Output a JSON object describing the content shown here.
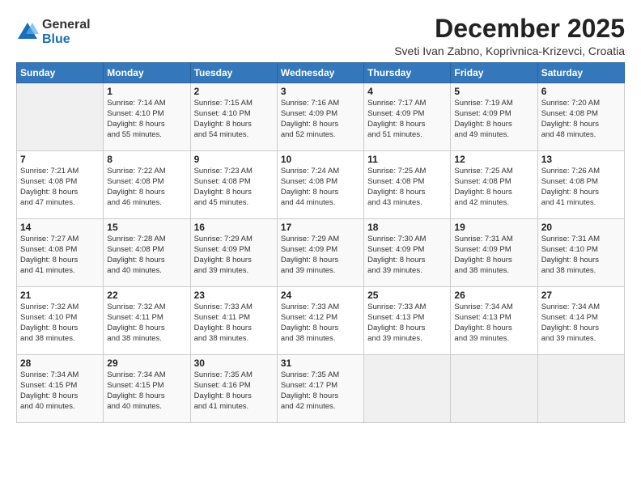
{
  "header": {
    "logo": {
      "general": "General",
      "blue": "Blue"
    },
    "title": "December 2025",
    "location": "Sveti Ivan Zabno, Koprivnica-Krizevci, Croatia"
  },
  "days_of_week": [
    "Sunday",
    "Monday",
    "Tuesday",
    "Wednesday",
    "Thursday",
    "Friday",
    "Saturday"
  ],
  "weeks": [
    [
      {
        "day": "",
        "info": ""
      },
      {
        "day": "1",
        "info": "Sunrise: 7:14 AM\nSunset: 4:10 PM\nDaylight: 8 hours\nand 55 minutes."
      },
      {
        "day": "2",
        "info": "Sunrise: 7:15 AM\nSunset: 4:10 PM\nDaylight: 8 hours\nand 54 minutes."
      },
      {
        "day": "3",
        "info": "Sunrise: 7:16 AM\nSunset: 4:09 PM\nDaylight: 8 hours\nand 52 minutes."
      },
      {
        "day": "4",
        "info": "Sunrise: 7:17 AM\nSunset: 4:09 PM\nDaylight: 8 hours\nand 51 minutes."
      },
      {
        "day": "5",
        "info": "Sunrise: 7:19 AM\nSunset: 4:09 PM\nDaylight: 8 hours\nand 49 minutes."
      },
      {
        "day": "6",
        "info": "Sunrise: 7:20 AM\nSunset: 4:08 PM\nDaylight: 8 hours\nand 48 minutes."
      }
    ],
    [
      {
        "day": "7",
        "info": "Sunrise: 7:21 AM\nSunset: 4:08 PM\nDaylight: 8 hours\nand 47 minutes."
      },
      {
        "day": "8",
        "info": "Sunrise: 7:22 AM\nSunset: 4:08 PM\nDaylight: 8 hours\nand 46 minutes."
      },
      {
        "day": "9",
        "info": "Sunrise: 7:23 AM\nSunset: 4:08 PM\nDaylight: 8 hours\nand 45 minutes."
      },
      {
        "day": "10",
        "info": "Sunrise: 7:24 AM\nSunset: 4:08 PM\nDaylight: 8 hours\nand 44 minutes."
      },
      {
        "day": "11",
        "info": "Sunrise: 7:25 AM\nSunset: 4:08 PM\nDaylight: 8 hours\nand 43 minutes."
      },
      {
        "day": "12",
        "info": "Sunrise: 7:25 AM\nSunset: 4:08 PM\nDaylight: 8 hours\nand 42 minutes."
      },
      {
        "day": "13",
        "info": "Sunrise: 7:26 AM\nSunset: 4:08 PM\nDaylight: 8 hours\nand 41 minutes."
      }
    ],
    [
      {
        "day": "14",
        "info": "Sunrise: 7:27 AM\nSunset: 4:08 PM\nDaylight: 8 hours\nand 41 minutes."
      },
      {
        "day": "15",
        "info": "Sunrise: 7:28 AM\nSunset: 4:08 PM\nDaylight: 8 hours\nand 40 minutes."
      },
      {
        "day": "16",
        "info": "Sunrise: 7:29 AM\nSunset: 4:09 PM\nDaylight: 8 hours\nand 39 minutes."
      },
      {
        "day": "17",
        "info": "Sunrise: 7:29 AM\nSunset: 4:09 PM\nDaylight: 8 hours\nand 39 minutes."
      },
      {
        "day": "18",
        "info": "Sunrise: 7:30 AM\nSunset: 4:09 PM\nDaylight: 8 hours\nand 39 minutes."
      },
      {
        "day": "19",
        "info": "Sunrise: 7:31 AM\nSunset: 4:09 PM\nDaylight: 8 hours\nand 38 minutes."
      },
      {
        "day": "20",
        "info": "Sunrise: 7:31 AM\nSunset: 4:10 PM\nDaylight: 8 hours\nand 38 minutes."
      }
    ],
    [
      {
        "day": "21",
        "info": "Sunrise: 7:32 AM\nSunset: 4:10 PM\nDaylight: 8 hours\nand 38 minutes."
      },
      {
        "day": "22",
        "info": "Sunrise: 7:32 AM\nSunset: 4:11 PM\nDaylight: 8 hours\nand 38 minutes."
      },
      {
        "day": "23",
        "info": "Sunrise: 7:33 AM\nSunset: 4:11 PM\nDaylight: 8 hours\nand 38 minutes."
      },
      {
        "day": "24",
        "info": "Sunrise: 7:33 AM\nSunset: 4:12 PM\nDaylight: 8 hours\nand 38 minutes."
      },
      {
        "day": "25",
        "info": "Sunrise: 7:33 AM\nSunset: 4:13 PM\nDaylight: 8 hours\nand 39 minutes."
      },
      {
        "day": "26",
        "info": "Sunrise: 7:34 AM\nSunset: 4:13 PM\nDaylight: 8 hours\nand 39 minutes."
      },
      {
        "day": "27",
        "info": "Sunrise: 7:34 AM\nSunset: 4:14 PM\nDaylight: 8 hours\nand 39 minutes."
      }
    ],
    [
      {
        "day": "28",
        "info": "Sunrise: 7:34 AM\nSunset: 4:15 PM\nDaylight: 8 hours\nand 40 minutes."
      },
      {
        "day": "29",
        "info": "Sunrise: 7:34 AM\nSunset: 4:15 PM\nDaylight: 8 hours\nand 40 minutes."
      },
      {
        "day": "30",
        "info": "Sunrise: 7:35 AM\nSunset: 4:16 PM\nDaylight: 8 hours\nand 41 minutes."
      },
      {
        "day": "31",
        "info": "Sunrise: 7:35 AM\nSunset: 4:17 PM\nDaylight: 8 hours\nand 42 minutes."
      },
      {
        "day": "",
        "info": ""
      },
      {
        "day": "",
        "info": ""
      },
      {
        "day": "",
        "info": ""
      }
    ]
  ]
}
